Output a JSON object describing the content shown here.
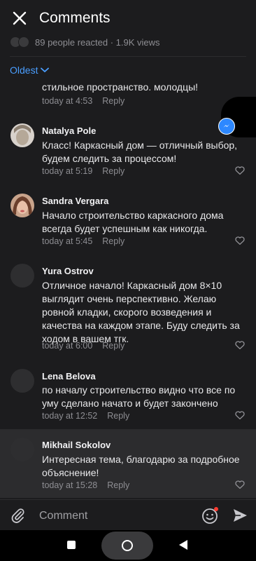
{
  "header": {
    "title": "Comments"
  },
  "reactions": {
    "text": "89 people reacted · 1.9K views"
  },
  "sort": {
    "label": "Oldest"
  },
  "comments": [
    {
      "name": "",
      "text": "стильное пространство. молодцы!",
      "time": "today at 4:53",
      "reply": "Reply"
    },
    {
      "name": "Natalya Pole",
      "text": "Класс! Каркасный дом — отличный выбор, будем следить за процессом!",
      "time": "today at 5:19",
      "reply": "Reply"
    },
    {
      "name": "Sandra Vergara",
      "text": "Начало строительство каркасного дома всегда будет успешным как никогда.",
      "time": "today at 5:45",
      "reply": "Reply"
    },
    {
      "name": "Yura Ostrov",
      "text": "Отличное начало! Каркасный дом 8×10 выглядит очень перспективно. Желаю ровной кладки, скорого возведения и качества на каждом этапе. Буду следить за ходом в вашем тгк.",
      "time": "today at 6:00",
      "reply": "Reply"
    },
    {
      "name": "Lena Belova",
      "text": "по началу строительство видно что все по уму сделано начато и будет закончено",
      "time": "today at 12:52",
      "reply": "Reply"
    },
    {
      "name": "Mikhail Sokolov",
      "text": "Интересная тема, благодарю за подробное объяснение!",
      "time": "today at 15:28",
      "reply": "Reply"
    }
  ],
  "composer": {
    "placeholder": "Comment"
  },
  "colors": {
    "accent": "#4a9eff",
    "background": "#1c1c1e",
    "highlight": "#2c2c2e"
  }
}
